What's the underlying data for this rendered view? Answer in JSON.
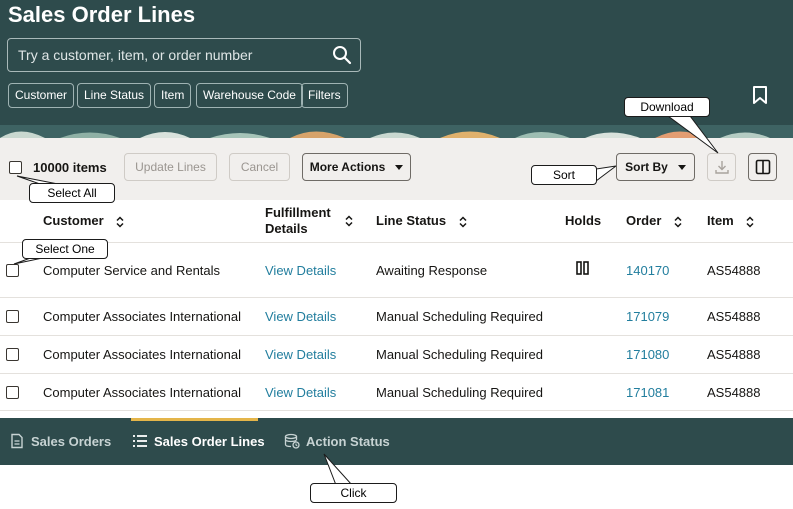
{
  "header": {
    "title": "Sales Order Lines",
    "search_placeholder": "Try a customer, item, or order number",
    "search_icon": "search-icon",
    "bookmark_icon": "bookmark-icon",
    "chips": [
      "Customer",
      "Line Status",
      "Item",
      "Warehouse Code",
      "Filters"
    ]
  },
  "toolbar": {
    "items_count": "10000 items",
    "update_lines": "Update Lines",
    "cancel": "Cancel",
    "more_actions": "More Actions",
    "sort_by": "Sort By",
    "download_icon": "download-icon",
    "panel_icon": "split-panel-icon"
  },
  "table": {
    "columns": {
      "customer": "Customer",
      "fulfillment_1": "Fulfillment",
      "fulfillment_2": "Details",
      "line_status": "Line Status",
      "holds": "Holds",
      "order": "Order",
      "item": "Item"
    },
    "rows": [
      {
        "customer": "Computer Service and Rentals",
        "details": "View Details",
        "status": "Awaiting Response",
        "hold_icon": "pause-icon",
        "order": "140170",
        "item": "AS54888"
      },
      {
        "customer": "Computer Associates International",
        "details": "View Details",
        "status": "Manual Scheduling Required",
        "order": "171079",
        "item": "AS54888"
      },
      {
        "customer": "Computer Associates International",
        "details": "View Details",
        "status": "Manual Scheduling Required",
        "order": "171080",
        "item": "AS54888"
      },
      {
        "customer": "Computer Associates International",
        "details": "View Details",
        "status": "Manual Scheduling Required",
        "order": "171081",
        "item": "AS54888"
      }
    ]
  },
  "bottom_nav": {
    "sales_orders": "Sales Orders",
    "sales_order_lines": "Sales Order Lines",
    "action_status": "Action Status"
  },
  "callouts": {
    "download": "Download",
    "sort": "Sort",
    "select_all": "Select All",
    "select_one": "Select One",
    "click": "Click"
  },
  "colors": {
    "header_bg": "#2e4b4c",
    "link": "#227e9e",
    "toolbar_bg": "#f1efed",
    "active_tab_accent": "#e4b54a"
  }
}
